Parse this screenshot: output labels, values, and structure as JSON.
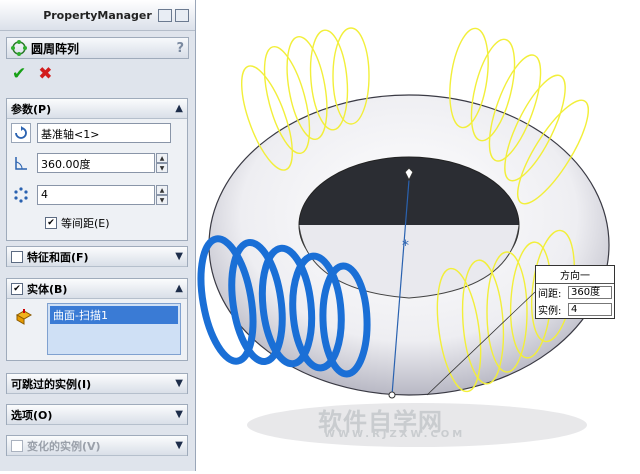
{
  "property_manager": {
    "title": "PropertyManager",
    "feature_title": "圆周阵列",
    "help": "?",
    "ok": "✔",
    "cancel": "✖"
  },
  "groups": {
    "parameters": {
      "title": "参数(P)",
      "axis": "基准轴<1>",
      "angle": "360.00度",
      "instances": "4",
      "equal_spacing_label": "等间距(E)",
      "equal_spacing_checked": true
    },
    "features_faces": {
      "title": "特征和面(F)"
    },
    "bodies": {
      "title": "实体(B)",
      "item": "曲面-扫描1"
    },
    "skip_instances": {
      "title": "可跳过的实例(I)"
    },
    "options": {
      "title": "选项(O)"
    },
    "varied_instances": {
      "title": "变化的实例(V)"
    }
  },
  "callout": {
    "title": "方向一",
    "spacing_label": "间距:",
    "spacing_value": "360度",
    "instances_label": "实例:",
    "instances_value": "4"
  },
  "watermark": {
    "text": "软件自学网",
    "url": "WWW.RJZXW.COM"
  },
  "colors": {
    "selected_body": "#1a6fd6",
    "preview": "#f2ef3a",
    "ok": "#16a016",
    "cancel": "#d21c1c"
  }
}
